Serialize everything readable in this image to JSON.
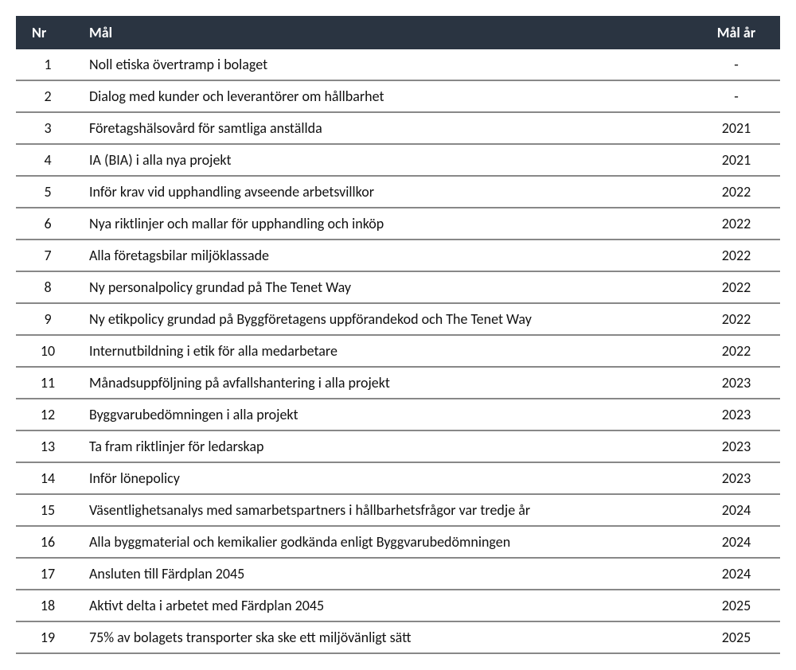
{
  "table": {
    "headers": {
      "nr": "Nr",
      "mal": "Mål",
      "year": "Mål år"
    },
    "rows": [
      {
        "nr": "1",
        "mal": "Noll etiska övertramp i bolaget",
        "year": "-"
      },
      {
        "nr": "2",
        "mal": "Dialog med kunder och leverantörer om hållbarhet",
        "year": "-"
      },
      {
        "nr": "3",
        "mal": "Företagshälsovård för samtliga anställda",
        "year": "2021"
      },
      {
        "nr": "4",
        "mal": "IA (BIA) i alla nya projekt",
        "year": "2021"
      },
      {
        "nr": "5",
        "mal": "Inför krav vid upphandling avseende arbetsvillkor",
        "year": "2022"
      },
      {
        "nr": "6",
        "mal": "Nya riktlinjer och mallar för upphandling och inköp",
        "year": "2022"
      },
      {
        "nr": "7",
        "mal": "Alla företagsbilar miljöklassade",
        "year": "2022"
      },
      {
        "nr": "8",
        "mal": "Ny personalpolicy grundad på The Tenet Way",
        "year": "2022"
      },
      {
        "nr": "9",
        "mal": "Ny etikpolicy grundad på Byggföretagens uppförandekod och The Tenet Way",
        "year": "2022"
      },
      {
        "nr": "10",
        "mal": "Internutbildning i etik för alla medarbetare",
        "year": "2022"
      },
      {
        "nr": "11",
        "mal": "Månadsuppföljning på avfallshantering i alla projekt",
        "year": "2023"
      },
      {
        "nr": "12",
        "mal": "Byggvarubedömningen i alla projekt",
        "year": "2023"
      },
      {
        "nr": "13",
        "mal": "Ta fram riktlinjer för ledarskap",
        "year": "2023"
      },
      {
        "nr": "14",
        "mal": "Inför lönepolicy",
        "year": "2023"
      },
      {
        "nr": "15",
        "mal": "Väsentlighetsanalys med samarbetspartners i hållbarhetsfrågor var tredje år",
        "year": "2024"
      },
      {
        "nr": "16",
        "mal": "Alla byggmaterial och kemikalier godkända enligt Byggvarubedömningen",
        "year": "2024"
      },
      {
        "nr": "17",
        "mal": "Ansluten till Färdplan 2045",
        "year": "2024"
      },
      {
        "nr": "18",
        "mal": "Aktivt delta i arbetet med Färdplan 2045",
        "year": "2025"
      },
      {
        "nr": "19",
        "mal": "75% av bolagets transporter ska ske ett miljövänligt sätt",
        "year": "2025"
      }
    ]
  }
}
